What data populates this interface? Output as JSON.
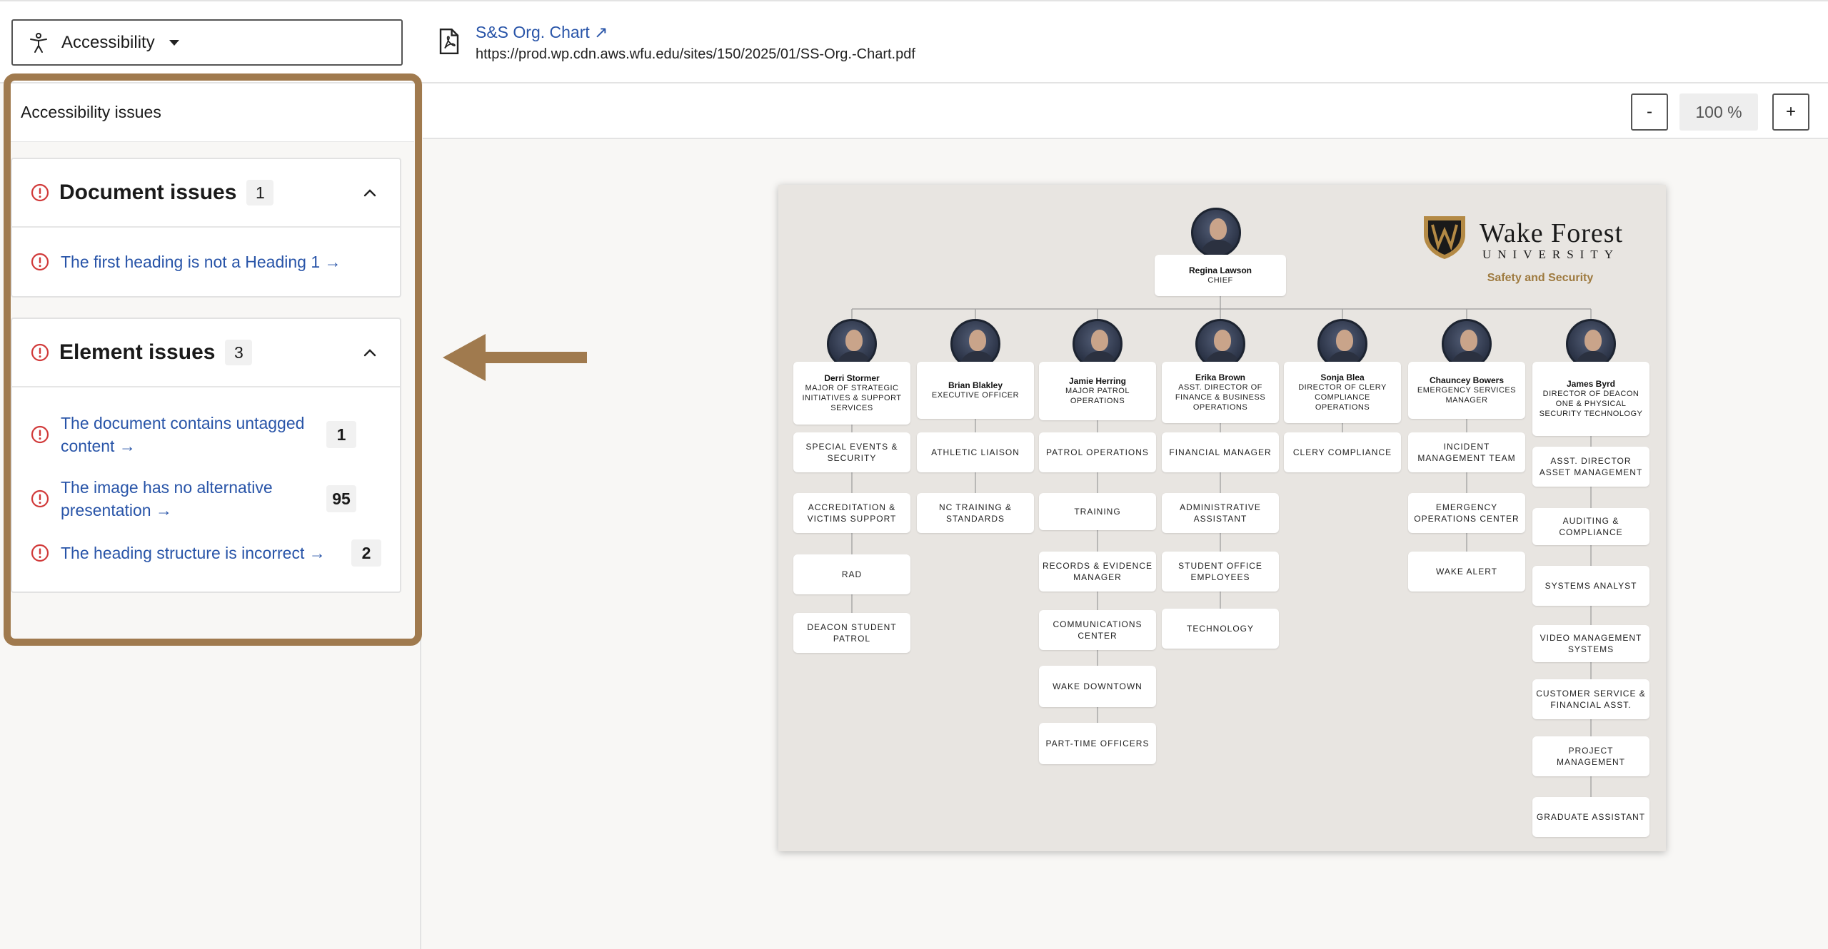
{
  "toolbar": {
    "accessibility_label": "Accessibility"
  },
  "document": {
    "title": "S&S Org. Chart ↗",
    "url": "https://prod.wp.cdn.aws.wfu.edu/sites/150/2025/01/SS-Org.-Chart.pdf"
  },
  "panel": {
    "header": "Accessibility issues",
    "document_issues": {
      "title": "Document issues",
      "count": "1",
      "items": [
        {
          "label": "The first heading is not a Heading 1 →"
        }
      ]
    },
    "element_issues": {
      "title": "Element issues",
      "count": "3",
      "items": [
        {
          "label": "The document contains untagged content →",
          "count": "1"
        },
        {
          "label": "The image has no alternative presentation →",
          "count": "95"
        },
        {
          "label": "The heading structure is incorrect →",
          "count": "2"
        }
      ]
    }
  },
  "zoom": {
    "minus": "-",
    "level": "100 %",
    "plus": "+"
  },
  "colors": {
    "link": "#2854a8",
    "warning": "#d13a3a",
    "highlight": "#a07a4e",
    "gold": "#9e7a3f"
  },
  "org_chart": {
    "logo_word": "Wake Forest",
    "logo_uni": "UNIVERSITY",
    "logo_sub": "Safety and Security",
    "chief": {
      "name": "Regina Lawson",
      "title": "CHIEF"
    },
    "columns": [
      {
        "name": "Derri Stormer",
        "title": "MAJOR OF STRATEGIC INITIATIVES & SUPPORT SERVICES",
        "units": [
          "SPECIAL EVENTS & SECURITY",
          "ACCREDITATION & VICTIMS SUPPORT",
          "RAD",
          "DEACON STUDENT PATROL"
        ]
      },
      {
        "name": "Brian Blakley",
        "title": "EXECUTIVE OFFICER",
        "units": [
          "ATHLETIC LIAISON",
          "NC TRAINING & STANDARDS"
        ]
      },
      {
        "name": "Jamie Herring",
        "title": "MAJOR PATROL OPERATIONS",
        "units": [
          "PATROL OPERATIONS",
          "TRAINING",
          "RECORDS & EVIDENCE MANAGER",
          "COMMUNICATIONS CENTER",
          "WAKE DOWNTOWN",
          "PART-TIME OFFICERS"
        ]
      },
      {
        "name": "Erika Brown",
        "title": "ASST. DIRECTOR OF FINANCE & BUSINESS OPERATIONS",
        "units": [
          "FINANCIAL MANAGER",
          "ADMINISTRATIVE ASSISTANT",
          "STUDENT OFFICE EMPLOYEES",
          "TECHNOLOGY"
        ]
      },
      {
        "name": "Sonja Blea",
        "title": "DIRECTOR OF CLERY COMPLIANCE OPERATIONS",
        "units": [
          "CLERY COMPLIANCE"
        ]
      },
      {
        "name": "Chauncey Bowers",
        "title": "EMERGENCY SERVICES MANAGER",
        "units": [
          "INCIDENT MANAGEMENT TEAM",
          "EMERGENCY OPERATIONS CENTER",
          "WAKE ALERT"
        ]
      },
      {
        "name": "James Byrd",
        "title": "DIRECTOR OF DEACON ONE & PHYSICAL SECURITY TECHNOLOGY",
        "units": [
          "ASST. DIRECTOR ASSET MANAGEMENT",
          "AUDITING & COMPLIANCE",
          "SYSTEMS ANALYST",
          "VIDEO MANAGEMENT SYSTEMS",
          "CUSTOMER SERVICE & FINANCIAL ASST.",
          "PROJECT MANAGEMENT",
          "GRADUATE ASSISTANT"
        ]
      }
    ]
  }
}
